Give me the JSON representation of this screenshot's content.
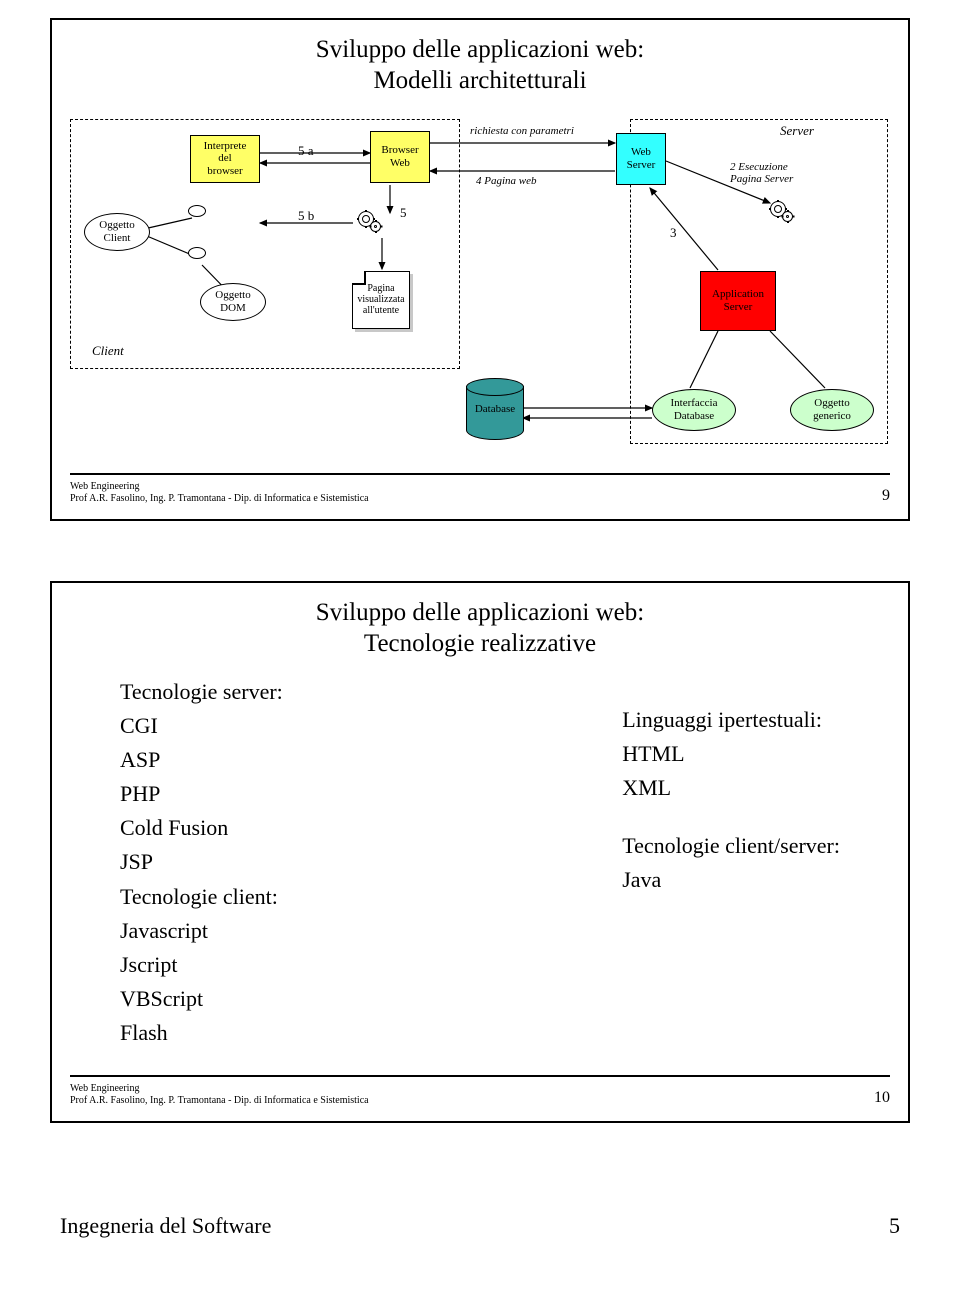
{
  "slide1": {
    "title_line1": "Sviluppo delle applicazioni web:",
    "title_line2": "Modelli architetturali",
    "interprete": "Interprete\ndel\nbrowser",
    "browser_web": "Browser\nWeb",
    "web_server": "Web\nServer",
    "pagina_vis": "Pagina\nvisualizzata\nall'utente",
    "oggetto_client": "Oggetto\nClient",
    "oggetto_dom": "Oggetto\nDOM",
    "app_server": "Application\nServer",
    "client_label": "Client",
    "server_label": "Server",
    "richiesta": "richiesta con parametri",
    "pagina_web": "4 Pagina web",
    "label_5a": "5 a",
    "label_5b": "5 b",
    "label_5": "5",
    "label_3": "3",
    "exec": "2 Esecuzione\nPagina Server",
    "database": "Database",
    "interfaccia": "Interfaccia\nDatabase",
    "og_generico": "Oggetto\ngenerico",
    "footer1": "Web Engineering",
    "footer2": "Prof  A.R. Fasolino, Ing. P. Tramontana - Dip. di Informatica e Sistemistica",
    "page_no": "9"
  },
  "slide2": {
    "title_line1": "Sviluppo delle applicazioni web:",
    "title_line2": "Tecnologie realizzative",
    "server_head": "Tecnologie server:",
    "server_items": [
      "CGI",
      "ASP",
      "PHP",
      "Cold Fusion",
      "JSP"
    ],
    "client_head": "Tecnologie client:",
    "client_items": [
      "Javascript",
      "Jscript",
      "VBScript",
      "Flash"
    ],
    "r1_head": "Linguaggi ipertestuali:",
    "r1_items": [
      "HTML",
      "XML"
    ],
    "r2_head": "Tecnologie client/server:",
    "r2_items": [
      "Java"
    ],
    "footer1": "Web Engineering",
    "footer2": "Prof  A.R. Fasolino, Ing. P. Tramontana - Dip. di Informatica e Sistemistica",
    "page_no": "10"
  },
  "bottom": {
    "left": "Ingegneria del Software",
    "right": "5"
  }
}
